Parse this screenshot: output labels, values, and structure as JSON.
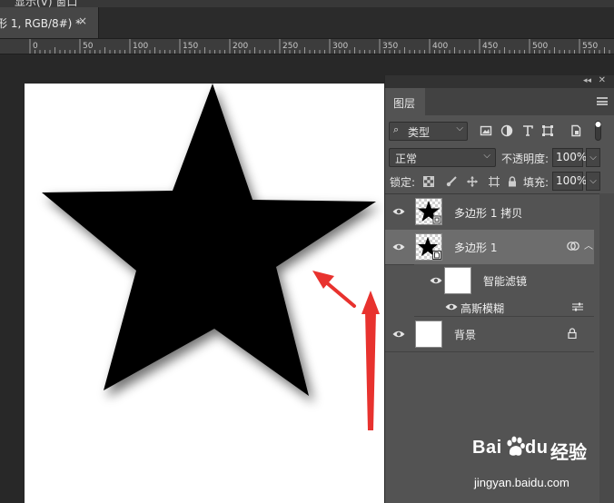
{
  "menubar": {
    "partial_text": "显示(V)  窗口"
  },
  "document_tab": {
    "title": "形 1, RGB/8#) *",
    "close": "×"
  },
  "ruler": {
    "ticks": [
      "0",
      "50",
      "100",
      "150",
      "200",
      "250",
      "300",
      "350",
      "400",
      "450",
      "500",
      "550"
    ]
  },
  "layers_panel": {
    "tab_label": "图层",
    "filter_kind": "类型",
    "blend_mode": "正常",
    "opacity_label": "不透明度:",
    "opacity_value": "100%",
    "lock_label": "锁定:",
    "fill_label": "填充:",
    "fill_value": "100%",
    "layers": [
      {
        "name": "多边形 1 拷贝",
        "type": "shape",
        "selected": false
      },
      {
        "name": "多边形 1",
        "type": "smart-object",
        "selected": true
      },
      {
        "name": "背景",
        "type": "background",
        "locked": true,
        "selected": false
      }
    ],
    "smart_filters": {
      "label": "智能滤镜",
      "filter_name": "高斯模糊"
    }
  },
  "watermark": {
    "brand": "Bai",
    "brand_icon": "paw-icon",
    "brand_suffix": "du",
    "brand_cn": "经验",
    "url": "jingyan.baidu.com"
  },
  "colors": {
    "arrow_red": "#e8322e",
    "panel_bg": "#535353",
    "selected_layer": "#6d6d6d",
    "workspace_bg": "#282828"
  }
}
